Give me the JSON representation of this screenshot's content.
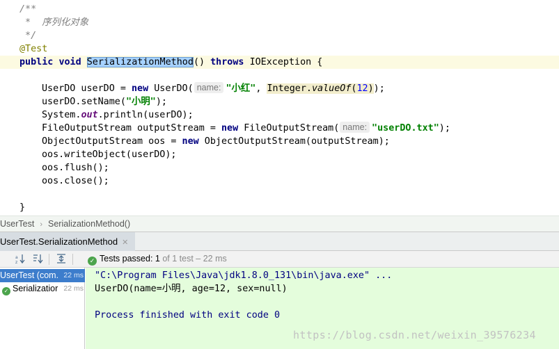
{
  "editor": {
    "doc_open": "/**",
    "doc_body": " *  序列化对象",
    "doc_close": " */",
    "annotation": "@Test",
    "sig_public": "public",
    "sig_void": "void",
    "method_name": "SerializationMethod",
    "sig_parens": "()",
    "sig_throws": "throws",
    "sig_exception": "IOException {",
    "l1_a": "UserDO userDO = ",
    "l1_new": "new",
    "l1_b": " UserDO(",
    "l1_hint": "name:",
    "l1_str": "\"小红\"",
    "l1_c": ", ",
    "l1_integer": "Integer.",
    "l1_valueof": "valueOf",
    "l1_paren_open": "(",
    "l1_num": "12",
    "l1_paren_close": ")",
    "l1_end": ");",
    "l2_a": "userDO.setName(",
    "l2_str": "\"小明\"",
    "l2_end": ");",
    "l3_a": "System.",
    "l3_out": "out",
    "l3_end": ".println(userDO);",
    "l4_a": "FileOutputStream outputStream = ",
    "l4_new": "new",
    "l4_b": " FileOutputStream(",
    "l4_hint": "name:",
    "l4_str": "\"userDO.txt\"",
    "l4_end": ");",
    "l5_a": "ObjectOutputStream oos = ",
    "l5_new": "new",
    "l5_end": " ObjectOutputStream(outputStream);",
    "l6": "oos.writeObject(userDO);",
    "l7": "oos.flush();",
    "l8": "oos.close();",
    "close_brace": "}"
  },
  "breadcrumb": {
    "class_name": "UserTest",
    "separator": "›",
    "method": "SerializationMethod()"
  },
  "run_tab": {
    "label": "UserTest.SerializationMethod",
    "close": "✕"
  },
  "toolbar": {
    "status_label": "Tests passed:",
    "passed_count": "1",
    "status_rest": "of 1 test – 22 ms"
  },
  "tree": {
    "root_label": "UserTest (com.",
    "root_duration": "22 ms",
    "child_label": "Serializatior",
    "child_duration": "22 ms"
  },
  "console": {
    "command": "\"C:\\Program Files\\Java\\jdk1.8.0_131\\bin\\java.exe\" ...",
    "output": "UserDO(name=小明, age=12, sex=null)",
    "exit": "Process finished with exit code 0"
  },
  "watermark": "https://blog.csdn.net/weixin_39576234",
  "colors": {
    "keyword": "#000080",
    "string": "#008000",
    "console_bg": "#e4fddc",
    "pass_green": "#4ca44c",
    "selection": "#3d7dcc"
  },
  "icons": [
    "sort-alpha-icon",
    "sort-duration-icon",
    "expand-icon",
    "test-passed-icon"
  ]
}
